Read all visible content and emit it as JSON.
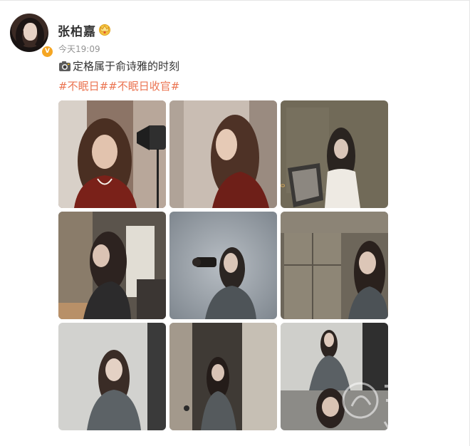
{
  "post": {
    "author": {
      "name": "张柏嘉",
      "avatar_icon": "user-avatar-photo",
      "verified_icon": "verified-v-icon",
      "verified_glyph": "V",
      "badge_icon": "crown-badge-icon"
    },
    "timestamp": "今天19:09",
    "text": "定格属于俞诗雅的时刻",
    "text_icon": "camera-icon",
    "hashtags": [
      "#不眠日#",
      "#不眠日收官#"
    ],
    "photos": [
      {
        "icon": "photo-portrait-red-jacket-front",
        "tone": "#8a6a5a"
      },
      {
        "icon": "photo-portrait-red-jacket-profile",
        "tone": "#b7a8a0"
      },
      {
        "icon": "photo-woman-reading-magazine",
        "tone": "#6e6552"
      },
      {
        "icon": "photo-woman-looking-back-room",
        "tone": "#5a524c"
      },
      {
        "icon": "photo-woman-with-camera",
        "tone": "#9ea4aa"
      },
      {
        "icon": "photo-woman-by-shelf",
        "tone": "#7a7264"
      },
      {
        "icon": "photo-woman-denim-white-wall",
        "tone": "#c3c3c0"
      },
      {
        "icon": "photo-woman-in-doorway",
        "tone": "#6f6b64"
      },
      {
        "icon": "photo-woman-posing-collage",
        "tone": "#9c9b97"
      }
    ]
  },
  "colors": {
    "hashtag": "#eb7350",
    "verified": "#f5a623",
    "name": "#333333",
    "timestamp": "#939393"
  }
}
